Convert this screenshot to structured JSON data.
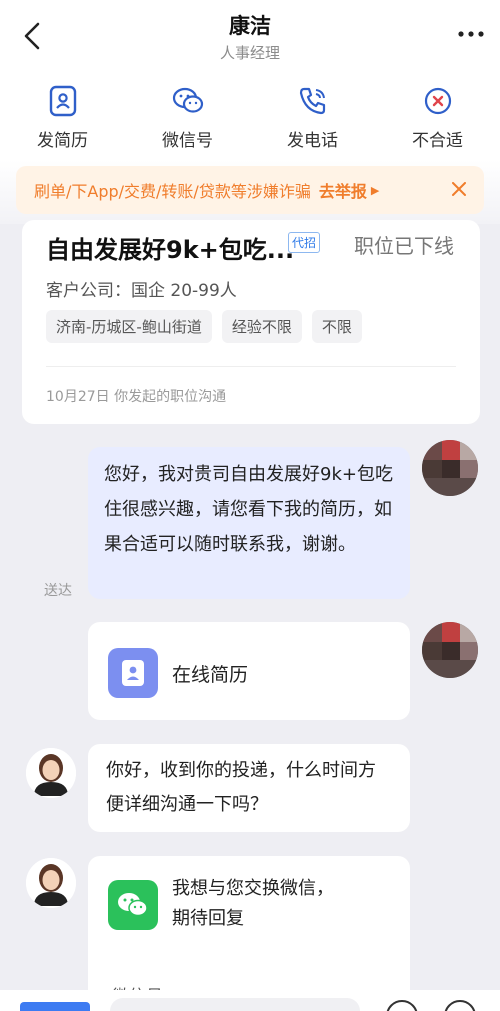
{
  "header": {
    "title": "康洁",
    "subtitle": "人事经理"
  },
  "actions": [
    {
      "label": "发简历",
      "icon": "resume-icon"
    },
    {
      "label": "微信号",
      "icon": "wechat-icon"
    },
    {
      "label": "发电话",
      "icon": "phone-icon"
    },
    {
      "label": "不合适",
      "icon": "not-suitable-icon"
    }
  ],
  "warning": {
    "text": "刷单/下App/交费/转账/贷款等涉嫌诈骗",
    "report": "去举报",
    "color": "#f07d2c"
  },
  "job": {
    "title": "自由发展好9k+包吃...",
    "tag": "代招",
    "status": "职位已下线",
    "company": "客户公司：国企  20-99人",
    "tags": [
      "济南-历城区-鲍山街道",
      "经验不限",
      "不限"
    ],
    "date_line": "10月27日 你发起的职位沟通"
  },
  "messages": {
    "sent_text": "您好，我对贵司自由发展好9k+包吃住很感兴趣，请您看下我的简历，如果合适可以随时联系我，谢谢。",
    "delivered": "送达",
    "resume_card": "在线简历",
    "hr_reply": "你好，收到你的投递，什么时间方便详细沟通一下吗？",
    "wechat_card_line1": "我想与您交换微信，",
    "wechat_card_line2": "期待回复",
    "wechat_cut": "微信号"
  },
  "colors": {
    "accent": "#3d7bf2",
    "sent_bubble": "#e8ecff",
    "wechat_green": "#2bc15b",
    "resume_blue": "#7c8ff0"
  }
}
